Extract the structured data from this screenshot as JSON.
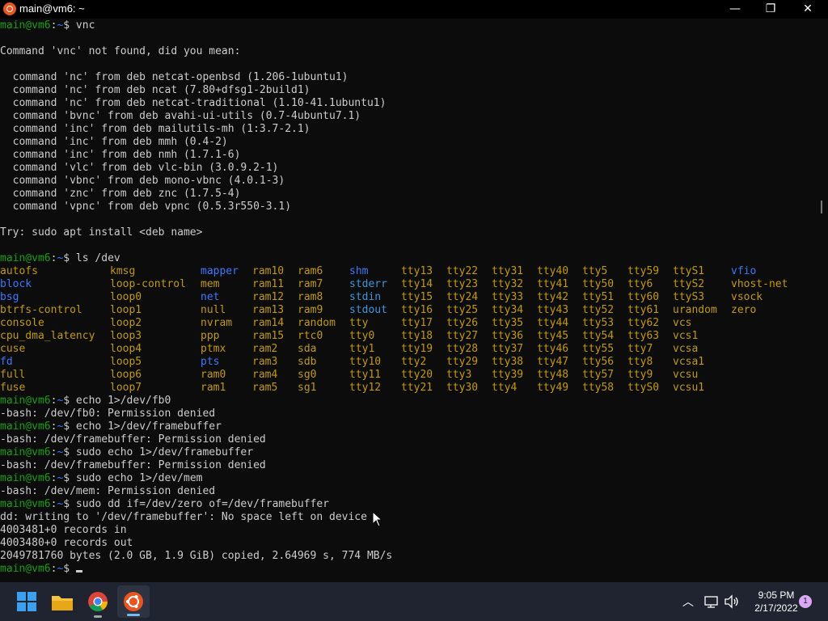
{
  "window": {
    "title": "main@vm6: ~",
    "controls": {
      "minimize": "—",
      "maximize": "❐",
      "close": "✕"
    }
  },
  "terminal": {
    "prompt": {
      "user_host": "main@vm6",
      "sep": ":",
      "path": "~",
      "sign": "$"
    },
    "block1": {
      "command": " vnc",
      "blank": "",
      "not_found": "Command 'vnc' not found, did you mean:",
      "suggestions": [
        "  command 'nc' from deb netcat-openbsd (1.206-1ubuntu1)",
        "  command 'nc' from deb ncat (7.80+dfsg1-2build1)",
        "  command 'nc' from deb netcat-traditional (1.10-41.1ubuntu1)",
        "  command 'bvnc' from deb avahi-ui-utils (0.7-4ubuntu7.1)",
        "  command 'inc' from deb mailutils-mh (1:3.7-2.1)",
        "  command 'inc' from deb mmh (0.4-2)",
        "  command 'inc' from deb nmh (1.7.1-6)",
        "  command 'vlc' from deb vlc-bin (3.0.9.2-1)",
        "  command 'vbnc' from deb mono-vbnc (4.0.1-3)",
        "  command 'znc' from deb znc (1.7.5-4)",
        "  command 'vpnc' from deb vpnc (0.5.3r550-3.1)"
      ],
      "try": "Try: sudo apt install <deb name>"
    },
    "ls_command": " ls /dev",
    "ls_rows": [
      [
        "autofs",
        "kmsg",
        "mapper",
        "ram10",
        "ram6",
        "shm",
        "tty13",
        "tty22",
        "tty31",
        "tty40",
        "tty5",
        "tty59",
        "ttyS1",
        "vfio"
      ],
      [
        "block",
        "loop-control",
        "mem",
        "ram11",
        "ram7",
        "stderr",
        "tty14",
        "tty23",
        "tty32",
        "tty41",
        "tty50",
        "tty6",
        "ttyS2",
        "vhost-net"
      ],
      [
        "bsg",
        "loop0",
        "net",
        "ram12",
        "ram8",
        "stdin",
        "tty15",
        "tty24",
        "tty33",
        "tty42",
        "tty51",
        "tty60",
        "ttyS3",
        "vsock"
      ],
      [
        "btrfs-control",
        "loop1",
        "null",
        "ram13",
        "ram9",
        "stdout",
        "tty16",
        "tty25",
        "tty34",
        "tty43",
        "tty52",
        "tty61",
        "urandom",
        "zero"
      ],
      [
        "console",
        "loop2",
        "nvram",
        "ram14",
        "random",
        "tty",
        "tty17",
        "tty26",
        "tty35",
        "tty44",
        "tty53",
        "tty62",
        "vcs",
        ""
      ],
      [
        "cpu_dma_latency",
        "loop3",
        "ppp",
        "ram15",
        "rtc0",
        "tty0",
        "tty18",
        "tty27",
        "tty36",
        "tty45",
        "tty54",
        "tty63",
        "vcs1",
        ""
      ],
      [
        "cuse",
        "loop4",
        "ptmx",
        "ram2",
        "sda",
        "tty1",
        "tty19",
        "tty28",
        "tty37",
        "tty46",
        "tty55",
        "tty7",
        "vcsa",
        ""
      ],
      [
        "fd",
        "loop5",
        "pts",
        "ram3",
        "sdb",
        "tty10",
        "tty2",
        "tty29",
        "tty38",
        "tty47",
        "tty56",
        "tty8",
        "vcsa1",
        ""
      ],
      [
        "full",
        "loop6",
        "ram0",
        "ram4",
        "sg0",
        "tty11",
        "tty20",
        "tty3",
        "tty39",
        "tty48",
        "tty57",
        "tty9",
        "vcsu",
        ""
      ],
      [
        "fuse",
        "loop7",
        "ram1",
        "ram5",
        "sg1",
        "tty12",
        "tty21",
        "tty30",
        "tty4",
        "tty49",
        "tty58",
        "ttyS0",
        "vcsu1",
        ""
      ]
    ],
    "ls_colors": {
      "dir": "#3b78ff",
      "link": "#3a96dd",
      "device": "#c19c00",
      "plain": "#cccccc"
    },
    "later": [
      {
        "cmd": " echo 1>/dev/fb0",
        "out": "-bash: /dev/fb0: Permission denied"
      },
      {
        "cmd": " echo 1>/dev/framebuffer",
        "out": "-bash: /dev/framebuffer: Permission denied"
      },
      {
        "cmd": " sudo echo 1>/dev/framebuffer",
        "out": "-bash: /dev/framebuffer: Permission denied"
      },
      {
        "cmd": " sudo echo 1>/dev/mem",
        "out": "-bash: /dev/mem: Permission denied"
      }
    ],
    "dd": {
      "cmd": " sudo dd if=/dev/zero of=/dev/framebuffer",
      "out": [
        "dd: writing to '/dev/framebuffer': No space left on device",
        "4003481+0 records in",
        "4003480+0 records out",
        "2049781760 bytes (2.0 GB, 1.9 GiB) copied, 2.64969 s, 774 MB/s"
      ]
    }
  },
  "taskbar": {
    "apps": [
      {
        "name": "start-icon"
      },
      {
        "name": "file-explorer-icon"
      },
      {
        "name": "chrome-icon"
      },
      {
        "name": "ubuntu-terminal-icon"
      }
    ],
    "time": "9:05 PM",
    "date": "2/17/2022",
    "notification_count": "1"
  }
}
